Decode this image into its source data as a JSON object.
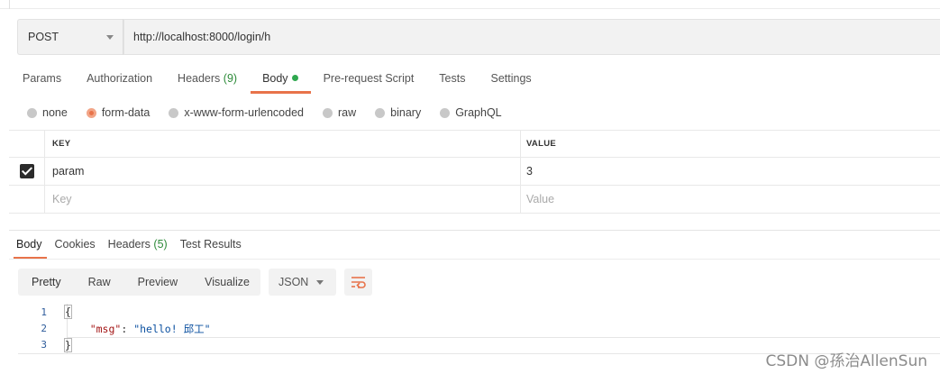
{
  "request": {
    "method": "POST",
    "url": "http://localhost:8000/login/h"
  },
  "request_tabs": [
    {
      "label": "Params"
    },
    {
      "label": "Authorization"
    },
    {
      "label": "Headers",
      "count": "(9)"
    },
    {
      "label": "Body"
    },
    {
      "label": "Pre-request Script"
    },
    {
      "label": "Tests"
    },
    {
      "label": "Settings"
    }
  ],
  "body_types": [
    "none",
    "form-data",
    "x-www-form-urlencoded",
    "raw",
    "binary",
    "GraphQL"
  ],
  "selected_body_type": "form-data",
  "params_table": {
    "headers": {
      "key": "KEY",
      "value": "VALUE"
    },
    "rows": [
      {
        "checked": true,
        "key": "param",
        "value": "3"
      }
    ],
    "placeholder": {
      "key": "Key",
      "value": "Value"
    }
  },
  "response_tabs": [
    {
      "label": "Body"
    },
    {
      "label": "Cookies"
    },
    {
      "label": "Headers",
      "count": "(5)"
    },
    {
      "label": "Test Results"
    }
  ],
  "view_modes": [
    "Pretty",
    "Raw",
    "Preview",
    "Visualize"
  ],
  "format": "JSON",
  "response_code": {
    "line_numbers": [
      "1",
      "2",
      "3"
    ],
    "open_brace": "{",
    "key": "\"msg\"",
    "colon": ": ",
    "value": "\"hello! 邱工\"",
    "close_brace": "}"
  },
  "watermark": "CSDN @孫治AllenSun",
  "colors": {
    "accent": "#e8734a",
    "active_dot": "#2fa84f",
    "count_green": "#2e8b3a"
  }
}
